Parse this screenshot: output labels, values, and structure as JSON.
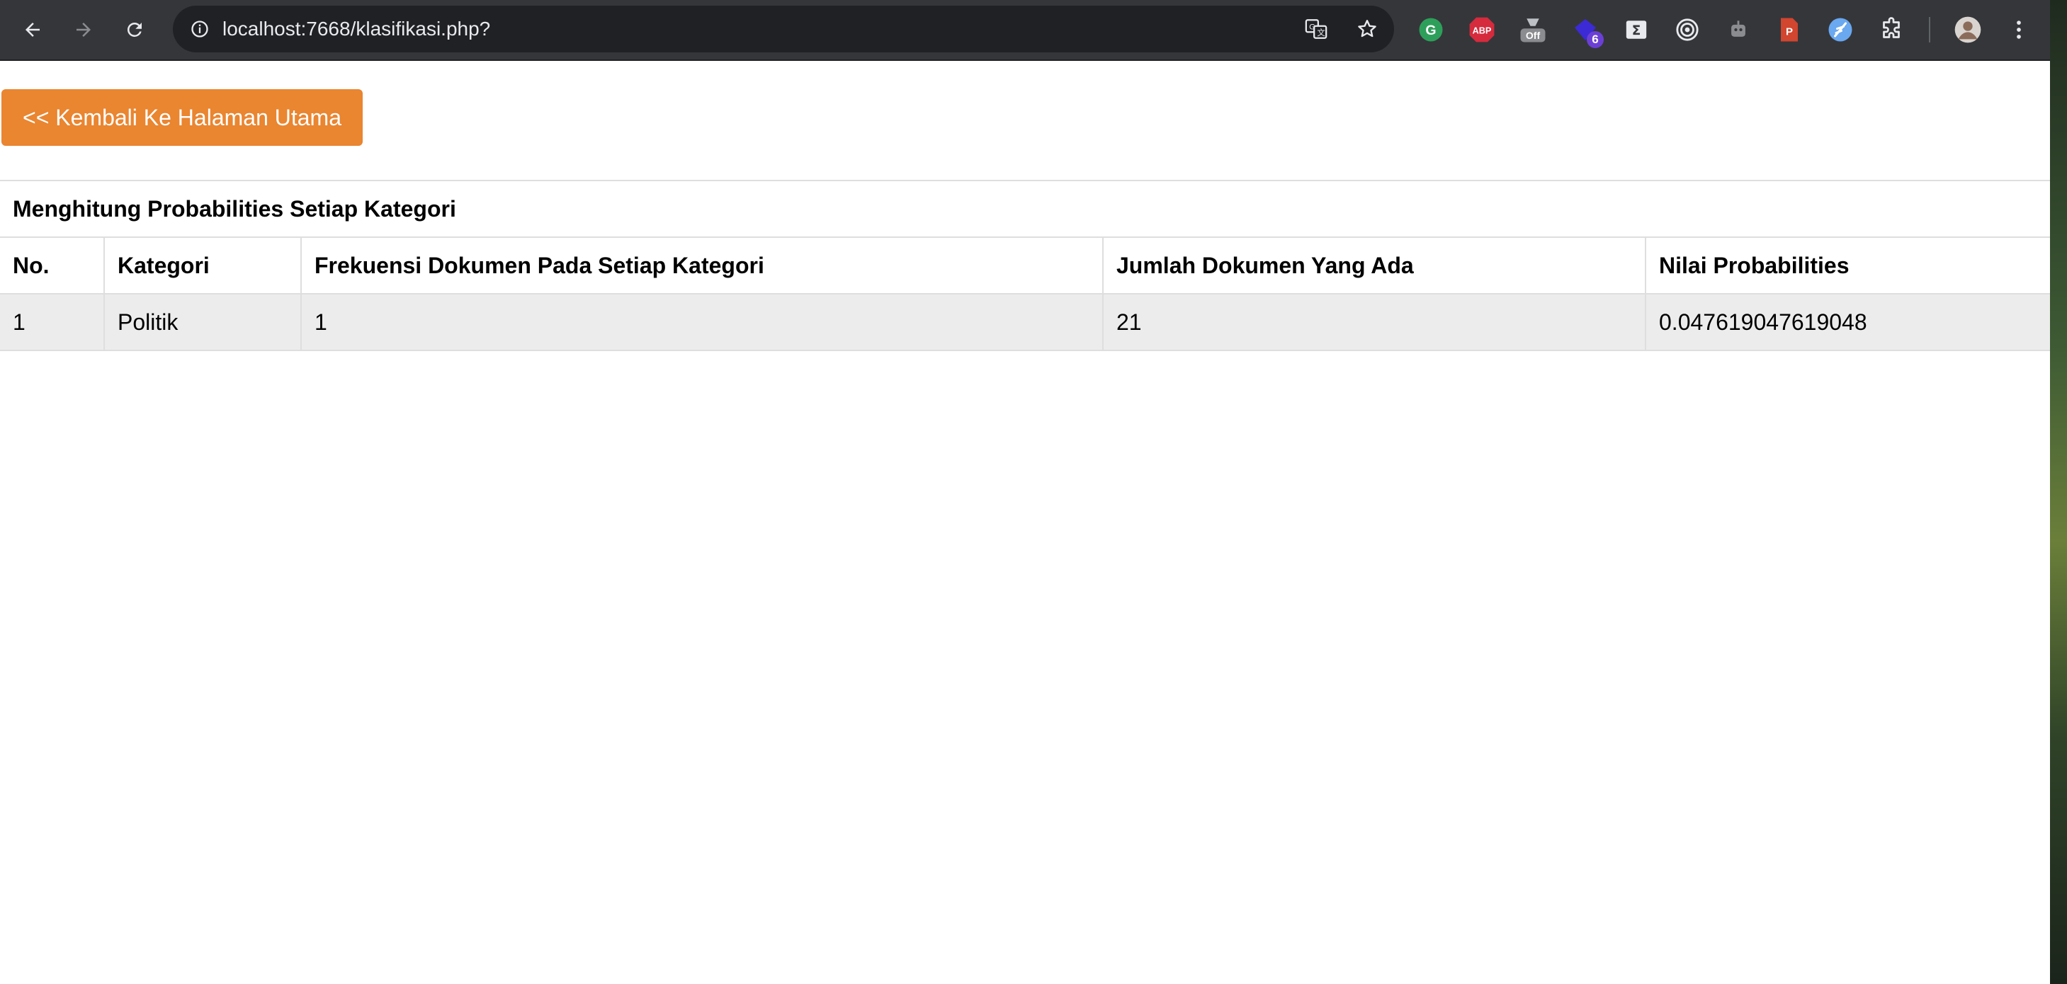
{
  "browser": {
    "url": "localhost:7668/klasifikasi.php?",
    "nav": {
      "back_icon": "arrow-left-icon",
      "forward_icon": "arrow-right-icon",
      "reload_icon": "reload-icon"
    },
    "omnibox_icons": [
      "site-info-icon",
      "translate-icon",
      "star-icon"
    ],
    "extensions": [
      {
        "name": "grammarly-icon",
        "color": "#2e9f5a"
      },
      {
        "name": "adblock-plus-icon",
        "label": "ABP",
        "color": "#d52b3d"
      },
      {
        "name": "extension-off-icon",
        "label": "Off",
        "color": "#8a8c90"
      },
      {
        "name": "extension-gem-icon",
        "badge": "6",
        "color": "#3b2ad6"
      },
      {
        "name": "sigma-icon",
        "color": "#e8eaed"
      },
      {
        "name": "target-icon",
        "color": "#e8eaed"
      },
      {
        "name": "robot-icon",
        "color": "#8a8c90"
      },
      {
        "name": "pdf-icon",
        "label": "P",
        "color": "#d2452f"
      },
      {
        "name": "feather-icon",
        "color": "#6aa8f0"
      },
      {
        "name": "puzzle-icon",
        "color": "#e8eaed"
      },
      {
        "name": "profile-avatar",
        "color": "#8b6b5a"
      },
      {
        "name": "menu-icon",
        "color": "#e8eaed"
      }
    ]
  },
  "page": {
    "back_button_label": "<< Kembali Ke Halaman Utama",
    "table": {
      "caption": "Menghitung Probabilities Setiap Kategori",
      "headers": [
        "No.",
        "Kategori",
        "Frekuensi Dokumen Pada Setiap Kategori",
        "Jumlah Dokumen Yang Ada",
        "Nilai Probabilities"
      ],
      "rows": [
        [
          "1",
          "Politik",
          "1",
          "21",
          "0.047619047619048"
        ]
      ]
    }
  },
  "colors": {
    "accent_button": "#ea8530",
    "row_background": "#ececec",
    "toolbar": "#35363a",
    "omnibox": "#202124"
  }
}
